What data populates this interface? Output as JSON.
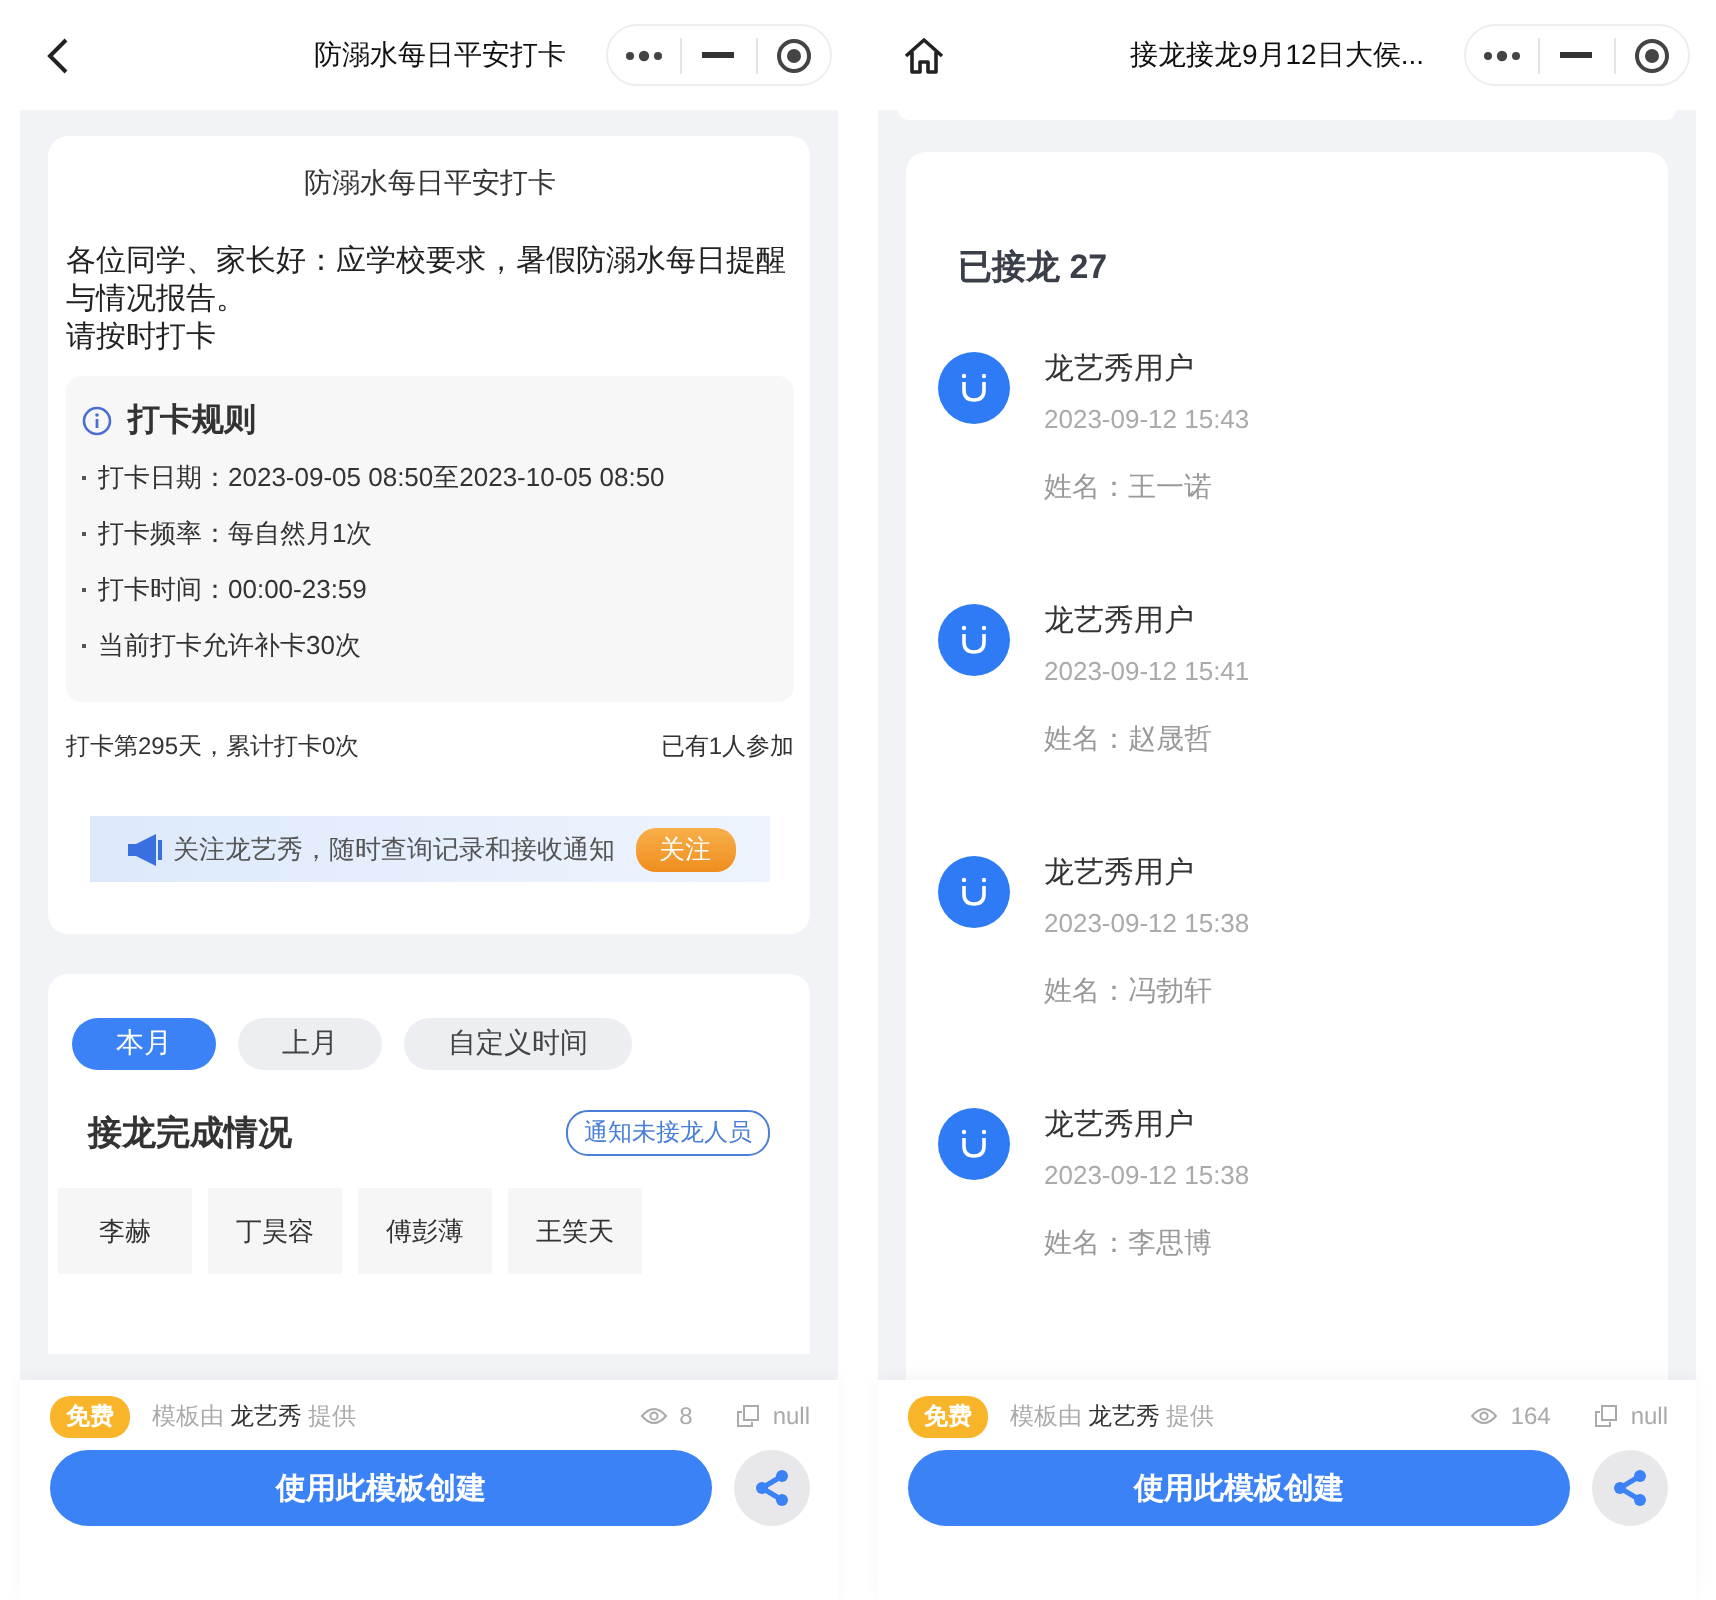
{
  "screens": [
    {
      "kind": "checkin",
      "nav": {
        "title": "防溺水每日平安打卡"
      },
      "intro_card": {
        "title": "防溺水每日平安打卡",
        "paragraphs": [
          "各位同学、家长好：应学校要求，暑假防溺水每日提醒与情况报告。",
          "请按时打卡"
        ],
        "rules": {
          "title": "打卡规则",
          "items": [
            "打卡日期：2023-09-05 08:50至2023-10-05 08:50",
            "打卡频率：每自然月1次",
            "打卡时间：00:00-23:59",
            "当前打卡允许补卡30次"
          ]
        },
        "progress": "打卡第295天，累计打卡0次",
        "participants": "已有1人参加",
        "follow_banner": {
          "text": "关注龙艺秀，随时查询记录和接收通知",
          "button": "关注"
        }
      },
      "completion_card": {
        "tabs": [
          {
            "label": "本月",
            "selected": true
          },
          {
            "label": "上月",
            "selected": false
          },
          {
            "label": "自定义时间",
            "selected": false
          }
        ],
        "title": "接龙完成情况",
        "notify_button": "通知未接龙人员",
        "names": [
          "李赫",
          "丁昊容",
          "傅彭薄",
          "王笑天"
        ]
      },
      "footer": {
        "badge": "免费",
        "provider_prefix": "模板由",
        "provider": "龙艺秀",
        "provider_suffix": "提供",
        "views": "8",
        "copies": "null",
        "create_button": "使用此模板创建"
      }
    },
    {
      "kind": "chain",
      "nav": {
        "title": "接龙接龙9月12日大侯..."
      },
      "entries_card": {
        "heading": "已接龙 27",
        "entries": [
          {
            "user": "龙艺秀用户",
            "time": "2023-09-12 15:43",
            "name": "姓名：王一诺"
          },
          {
            "user": "龙艺秀用户",
            "time": "2023-09-12 15:41",
            "name": "姓名：赵晟哲"
          },
          {
            "user": "龙艺秀用户",
            "time": "2023-09-12 15:38",
            "name": "姓名：冯勃轩"
          },
          {
            "user": "龙艺秀用户",
            "time": "2023-09-12 15:38",
            "name": "姓名：李思博"
          }
        ]
      },
      "footer": {
        "badge": "免费",
        "provider_prefix": "模板由",
        "provider": "龙艺秀",
        "provider_suffix": "提供",
        "views": "164",
        "copies": "null",
        "create_button": "使用此模板创建"
      }
    }
  ]
}
